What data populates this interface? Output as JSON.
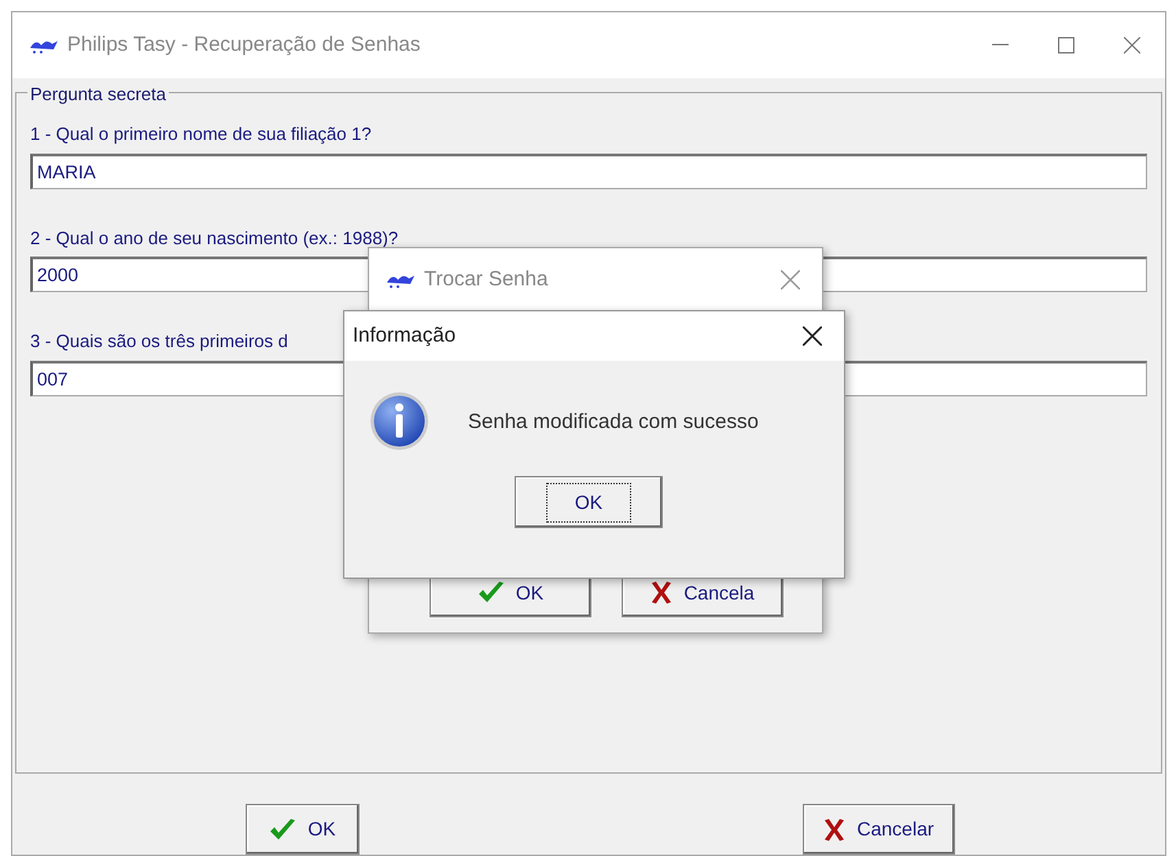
{
  "window": {
    "title": "Philips Tasy - Recuperação de Senhas"
  },
  "group": {
    "title": "Pergunta secreta",
    "questions": [
      {
        "label": "1 - Qual o primeiro nome de sua filiação 1?",
        "value": "MARIA"
      },
      {
        "label": "2 - Qual o ano de seu nascimento (ex.: 1988)?",
        "value": "2000"
      },
      {
        "label": "3 - Quais são os três primeiros d",
        "value": "007"
      }
    ]
  },
  "buttons": [
    {
      "kind": "ok",
      "label": "OK"
    },
    {
      "kind": "cancel",
      "label": "Cancelar"
    }
  ],
  "dialog": {
    "title": "Trocar Senha",
    "buttons": [
      {
        "kind": "ok",
        "label": "OK"
      },
      {
        "kind": "cancel",
        "label": "Cancela"
      }
    ]
  },
  "message_box": {
    "title": "Informação",
    "message": "Senha modificada com sucesso",
    "button": {
      "label": "OK",
      "focused": true
    }
  }
}
